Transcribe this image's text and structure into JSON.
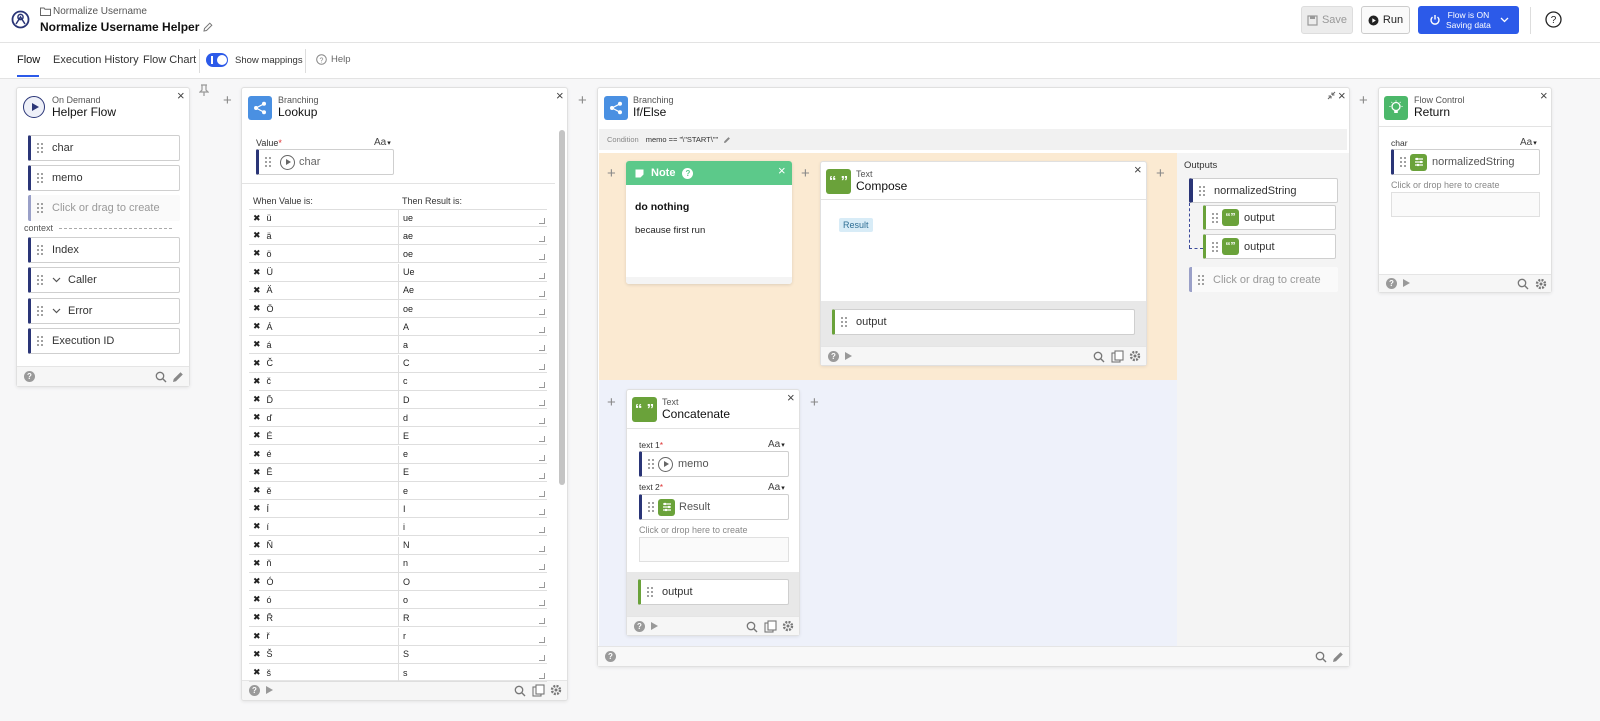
{
  "header": {
    "breadcrumb": "Normalize Username",
    "flow_name": "Normalize Username Helper",
    "save_label": "Save",
    "run_label": "Run",
    "flow_status_line1": "Flow is ON",
    "flow_status_line2": "Saving data"
  },
  "tabs": {
    "flow": "Flow",
    "history": "Execution History",
    "chart": "Flow Chart",
    "show_mappings": "Show mappings",
    "help": "Help"
  },
  "on_demand": {
    "type": "On Demand",
    "name": "Helper Flow",
    "fields": [
      "char",
      "memo"
    ],
    "create_placeholder": "Click or drag to create",
    "context_label": "context",
    "context_fields": [
      "Index",
      "Caller",
      "Error",
      "Execution ID"
    ]
  },
  "lookup": {
    "type": "Branching",
    "name": "Lookup",
    "value_label": "Value",
    "value_field": "char",
    "aa": "Aa",
    "col_when": "When Value is:",
    "col_then": "Then Result is:",
    "rows": [
      [
        "ü",
        "ue"
      ],
      [
        "ä",
        "ae"
      ],
      [
        "ö",
        "oe"
      ],
      [
        "Ü",
        "Ue"
      ],
      [
        "Ä",
        "Ae"
      ],
      [
        "Ö",
        "oe"
      ],
      [
        "Á",
        "A"
      ],
      [
        "á",
        "a"
      ],
      [
        "Č",
        "C"
      ],
      [
        "č",
        "c"
      ],
      [
        "Ď",
        "D"
      ],
      [
        "ď",
        "d"
      ],
      [
        "É",
        "E"
      ],
      [
        "é",
        "e"
      ],
      [
        "Ě",
        "E"
      ],
      [
        "ě",
        "e"
      ],
      [
        "Í",
        "I"
      ],
      [
        "í",
        "i"
      ],
      [
        "Ň",
        "N"
      ],
      [
        "ň",
        "n"
      ],
      [
        "Ó",
        "O"
      ],
      [
        "ó",
        "o"
      ],
      [
        "Ř",
        "R"
      ],
      [
        "ř",
        "r"
      ],
      [
        "Š",
        "S"
      ],
      [
        "š",
        "s"
      ]
    ]
  },
  "ifelse": {
    "type": "Branching",
    "name": "If/Else",
    "condition_label": "Condition",
    "condition_value": "memo == \"\\\"START\\\"\"",
    "outputs_label": "Outputs",
    "output_main": "normalizedString",
    "outputs": [
      "output",
      "output"
    ],
    "create_placeholder": "Click or drag to create"
  },
  "note": {
    "title": "Note",
    "heading": "do nothing",
    "body": "because first run"
  },
  "compose": {
    "type": "Text",
    "name": "Compose",
    "chip": "Result",
    "output": "output"
  },
  "concat": {
    "type": "Text",
    "name": "Concatenate",
    "text1_label": "text 1",
    "text1_value": "memo",
    "text2_label": "text 2",
    "text2_value": "Result",
    "drop_label": "Click or drop here to create",
    "output": "output",
    "aa": "Aa"
  },
  "return": {
    "type": "Flow Control",
    "name": "Return",
    "field_label": "char",
    "field_value": "normalizedString",
    "drop_label": "Click or drop here to create",
    "aa": "Aa"
  },
  "colors": {
    "accent": "#2c5ae9",
    "navy": "#2a3577",
    "green": "#6aa23a",
    "note_green": "#5cc98a",
    "branch_blue": "#4a90e2"
  }
}
